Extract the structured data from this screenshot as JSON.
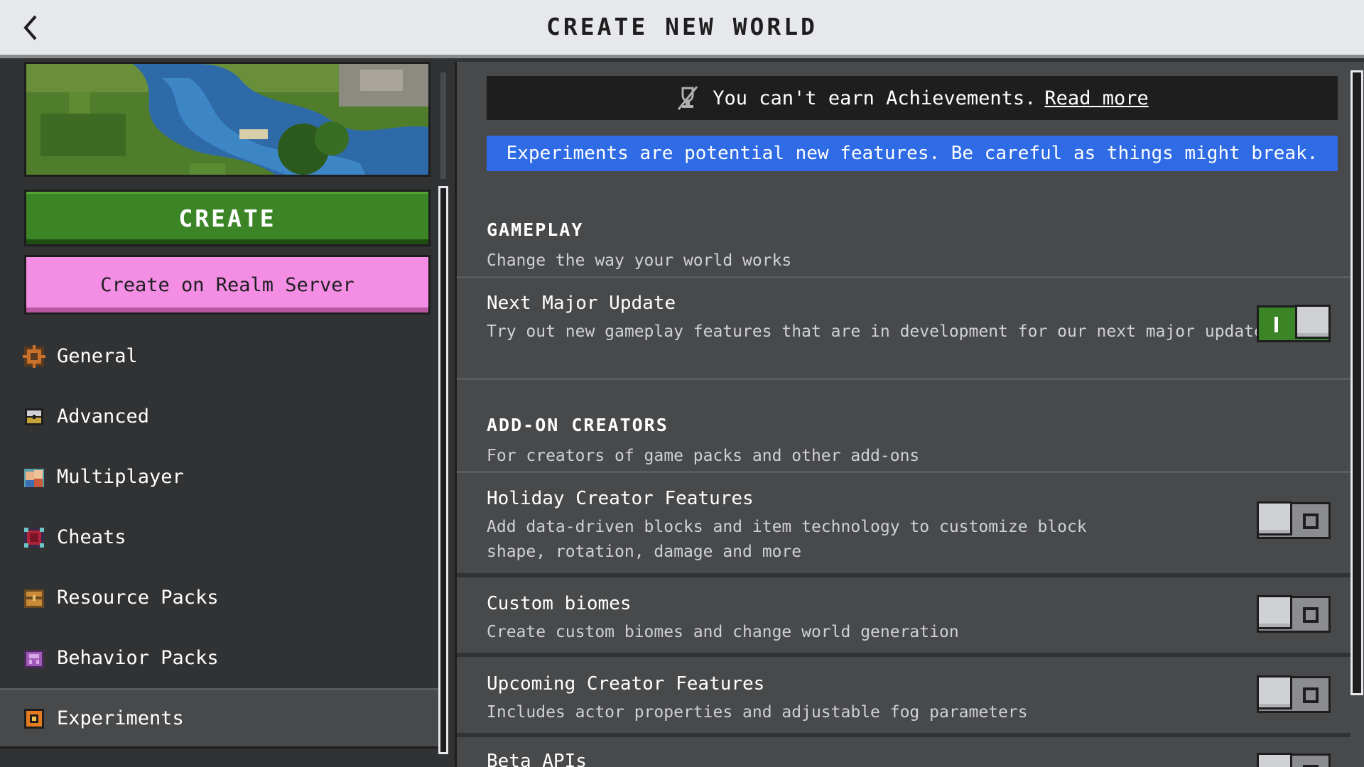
{
  "header": {
    "title": "CREATE NEW WORLD",
    "back_icon": "chevron-left-icon"
  },
  "left": {
    "create_label": "CREATE",
    "realm_label": "Create on Realm Server",
    "nav": [
      {
        "label": "General",
        "icon": "gear-icon"
      },
      {
        "label": "Advanced",
        "icon": "chest-icon"
      },
      {
        "label": "Multiplayer",
        "icon": "players-icon"
      },
      {
        "label": "Cheats",
        "icon": "cheats-icon"
      },
      {
        "label": "Resource Packs",
        "icon": "resource-pack-icon"
      },
      {
        "label": "Behavior Packs",
        "icon": "behavior-pack-icon"
      },
      {
        "label": "Experiments",
        "icon": "flask-icon",
        "active": true
      }
    ]
  },
  "right": {
    "notice_text": "You can't earn Achievements.",
    "notice_link": "Read more",
    "warning": "Experiments are potential new features. Be careful as things might break.",
    "sections": {
      "gameplay": {
        "title": "GAMEPLAY",
        "subtitle": "Change the way your world works",
        "settings": [
          {
            "name": "Next Major Update",
            "desc": "Try out new gameplay features that are in development for our next major update",
            "enabled": true
          }
        ]
      },
      "addon": {
        "title": "ADD-ON CREATORS",
        "subtitle": "For creators of game packs and other add-ons",
        "settings": [
          {
            "name": "Holiday Creator Features",
            "desc": "Add data-driven blocks and item technology to customize block shape, rotation, damage and more",
            "enabled": false
          },
          {
            "name": "Custom biomes",
            "desc": "Create custom biomes and change world generation",
            "enabled": false
          },
          {
            "name": "Upcoming Creator Features",
            "desc": "Includes actor properties and adjustable fog parameters",
            "enabled": false
          },
          {
            "name": "Beta APIs",
            "desc": "",
            "enabled": false
          }
        ]
      }
    }
  },
  "colors": {
    "create_green": "#3c8527",
    "realm_pink": "#f38ee4",
    "warning_blue": "#2e6be5",
    "toggle_on": "#3c8527"
  }
}
